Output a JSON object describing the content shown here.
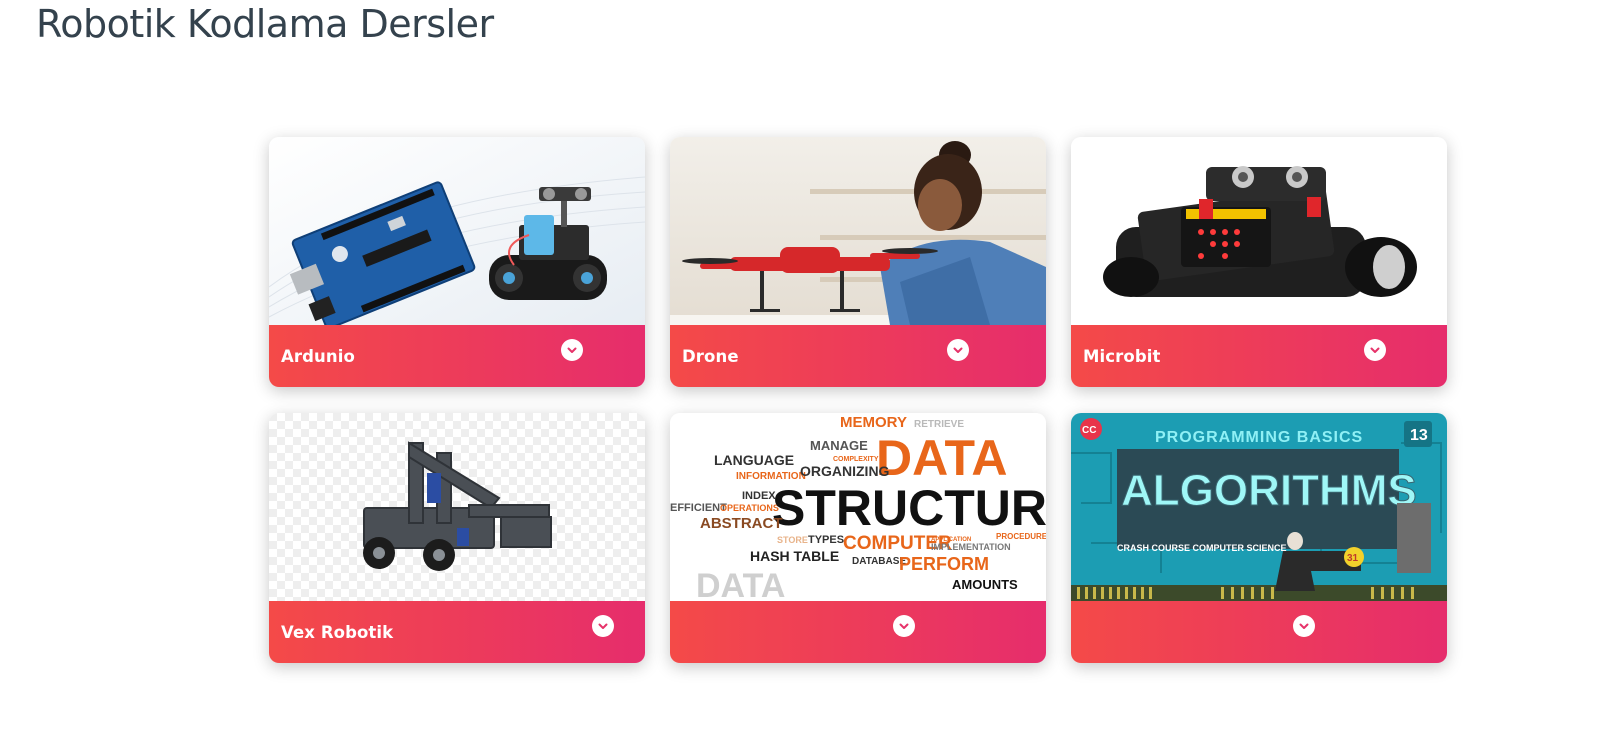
{
  "page": {
    "title": "Robotik Kodlama Dersler"
  },
  "cards": [
    {
      "label": "Ardunio",
      "image": "arduino-board-and-robot-kit",
      "expand_icon": "chevron-down-icon"
    },
    {
      "label": "Drone",
      "image": "girl-building-drone",
      "expand_icon": "chevron-down-icon"
    },
    {
      "label": "Microbit",
      "image": "microbit-robot-car",
      "expand_icon": "chevron-down-icon"
    },
    {
      "label": "Vex Robotik",
      "image": "vex-robot-vehicle",
      "expand_icon": "chevron-down-icon"
    },
    {
      "label": "",
      "image": "data-structure-word-cloud",
      "expand_icon": "chevron-down-icon",
      "image_words": [
        "MEMORY",
        "RETRIEVE",
        "MANAGE",
        "DATA",
        "LANGUAGE",
        "COMPLEXITY",
        "INFORMATION",
        "ORGANIZING",
        "INDEX",
        "EFFICIENT",
        "OPERATIONS",
        "STRUCTURE",
        "ABSTRACT",
        "STORE",
        "TYPES",
        "COMPUTER",
        "APPLICATION",
        "PROCEDURES",
        "IMPLEMENTATION",
        "HASH TABLE",
        "DATABASE",
        "PERFORM",
        "DATA",
        "AMOUNTS"
      ]
    },
    {
      "label": "",
      "image": "algorithms-crash-course",
      "expand_icon": "chevron-down-icon",
      "image_words": {
        "badge": "CC",
        "subtitle": "PROGRAMMING BASICS",
        "episode": "13",
        "title": "ALGORITHMS",
        "footer": "CRASH COURSE COMPUTER SCIENCE",
        "marker": "31"
      }
    }
  ],
  "colors": {
    "footer_gradient_start": "#f44a48",
    "footer_gradient_end": "#e62d6c",
    "title_color": "#34424d"
  }
}
